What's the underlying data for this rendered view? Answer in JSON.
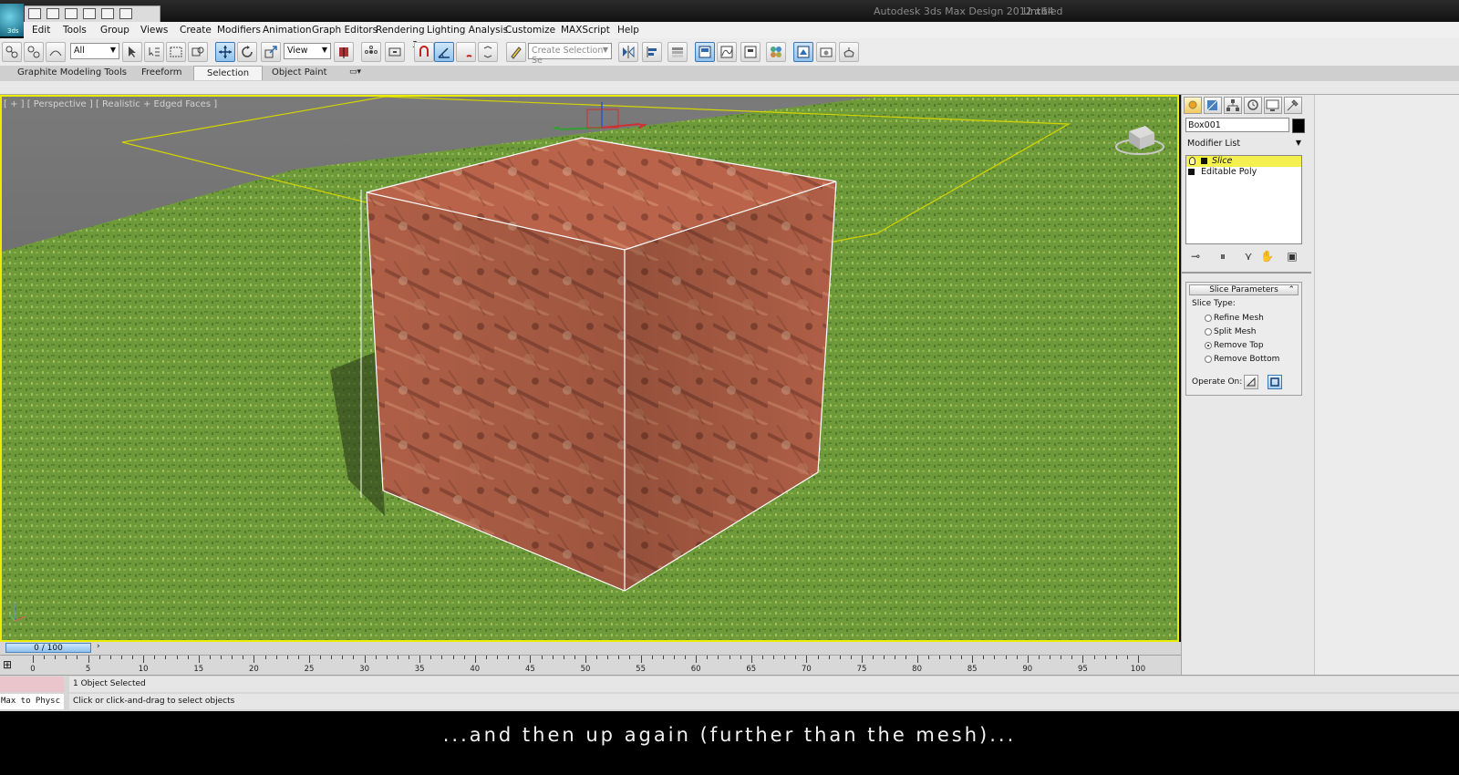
{
  "window": {
    "app_title": "Autodesk 3ds Max Design 2012 x64",
    "doc_title": "Untitled",
    "app_logo_text": "3ds"
  },
  "menu": [
    "Edit",
    "Tools",
    "Group",
    "Views",
    "Create",
    "Modifiers",
    "Animation",
    "Graph Editors",
    "Rendering",
    "Lighting Analysis",
    "Customize",
    "MAXScript",
    "Help"
  ],
  "toolbar": {
    "selection_filter": "All",
    "ref_coord": "View",
    "percent_symbol": "%",
    "snap_label": "3",
    "named_selection_placeholder": "Create Selection Se"
  },
  "ribbon": {
    "tabs": [
      "Graphite Modeling Tools",
      "Freeform",
      "Selection",
      "Object Paint"
    ],
    "selected_tab": "Selection"
  },
  "viewport": {
    "label": "[ + ] [ Perspective ] [ Realistic + Edged Faces ]",
    "border_color": "#ecec00",
    "object": "textured box (red marble)"
  },
  "command_panel": {
    "object_name": "Box001",
    "object_color": "#000000",
    "modifier_list": "Modifier List",
    "stack": [
      {
        "label": "Slice",
        "selected": true
      },
      {
        "label": "Editable Poly",
        "selected": false
      }
    ],
    "rollout": {
      "title": "Slice Parameters",
      "slice_type_label": "Slice Type:",
      "options": [
        "Refine Mesh",
        "Split Mesh",
        "Remove Top",
        "Remove Bottom"
      ],
      "selected_option": "Remove Top",
      "operate_on_label": "Operate On:"
    }
  },
  "timeline": {
    "frame_display": "0 / 100",
    "ticks": [
      "0",
      "5",
      "10",
      "15",
      "20",
      "25",
      "30",
      "35",
      "40",
      "45",
      "50",
      "55",
      "60",
      "65",
      "70",
      "75",
      "80",
      "85",
      "90",
      "95",
      "100"
    ]
  },
  "status": {
    "selection_status": "1 Object Selected",
    "prompt": "Click or click-and-drag to select objects",
    "listener_text": "Max to Physc"
  },
  "subtitle": "...and then up again (further than the mesh)..."
}
